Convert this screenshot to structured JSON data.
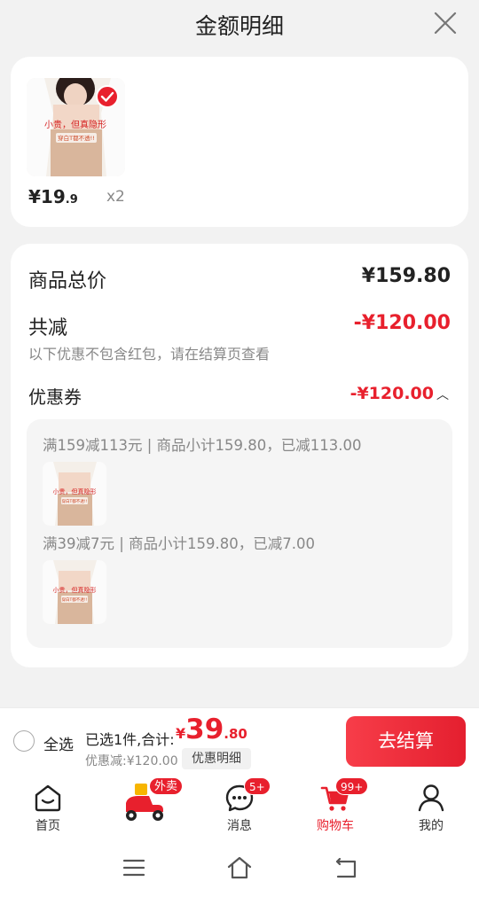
{
  "header": {
    "title": "金额明细"
  },
  "product": {
    "image_caption": "小贵，但真隐形",
    "image_subcaption": "穿白T都不透!!",
    "price_main": "¥19",
    "price_decimal": ".9",
    "quantity": "x2"
  },
  "summary": {
    "total_label": "商品总价",
    "total_value": "¥159.80",
    "reduce_label": "共减",
    "reduce_value": "-¥120.00",
    "note": "以下优惠不包含红包，请在结算页查看",
    "coupon_label": "优惠券",
    "coupon_value": "-¥120.00"
  },
  "coupons": [
    {
      "text": "满159减113元 | 商品小计159.80，已减113.00"
    },
    {
      "text": "满39减7元 | 商品小计159.80，已减7.00"
    }
  ],
  "bottom_bar": {
    "select_all": "全选",
    "selected_text": "已选1件,合计:",
    "amount_yen": "¥",
    "amount_int": "39",
    "amount_dec": ".80",
    "discount_text": "优惠减:¥120.00",
    "detail_tag": "优惠明细",
    "checkout_label": "去结算"
  },
  "tabs": [
    {
      "label": "首页",
      "icon": "home-icon"
    },
    {
      "label": "",
      "icon": "scooter-icon",
      "badge": "外卖"
    },
    {
      "label": "消息",
      "icon": "chat-icon",
      "badge": "5+"
    },
    {
      "label": "购物车",
      "icon": "cart-icon",
      "badge": "99+",
      "active": true
    },
    {
      "label": "我的",
      "icon": "profile-icon"
    }
  ],
  "colors": {
    "accent": "#e8202d",
    "background": "#f2f2f2"
  }
}
